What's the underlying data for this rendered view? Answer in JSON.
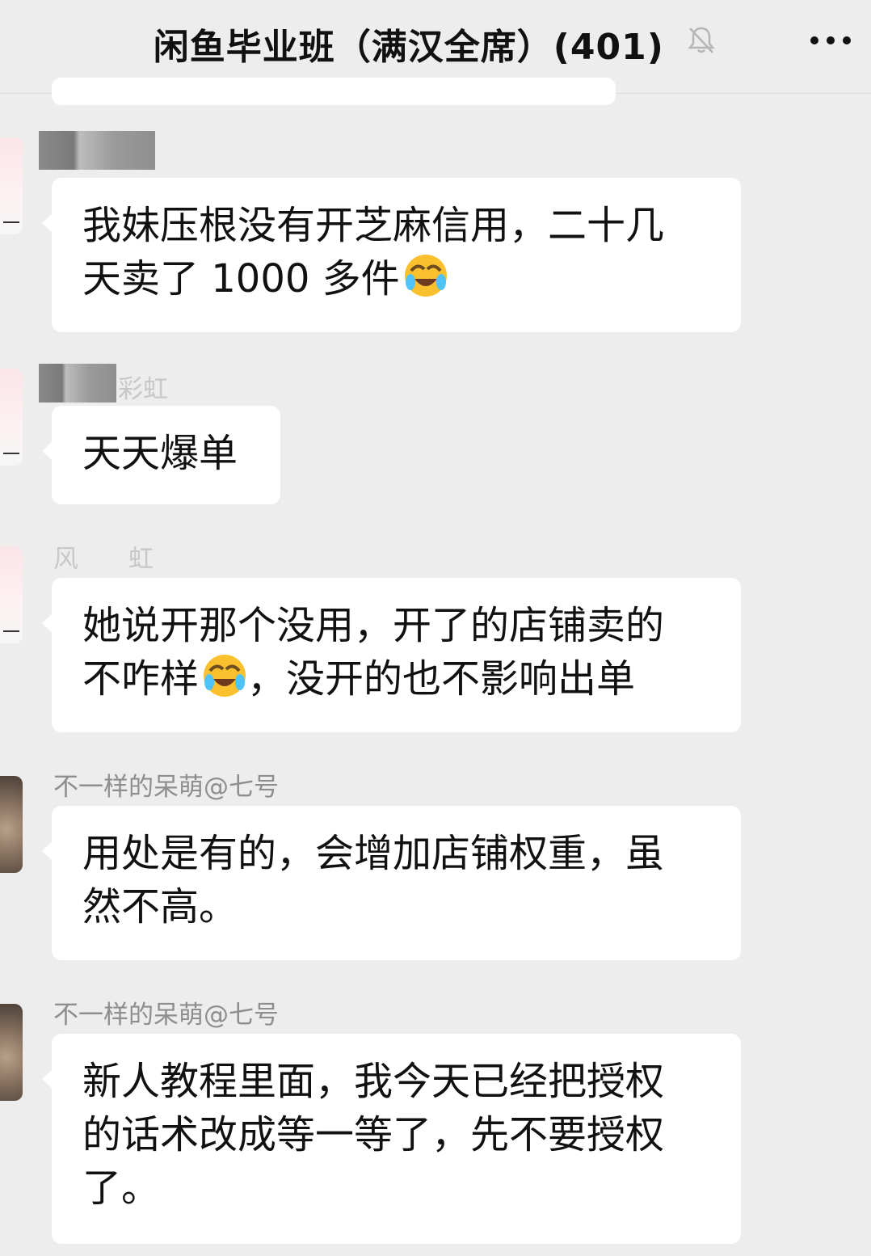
{
  "header": {
    "title": "闲鱼毕业班（满汉全席）(401)",
    "mute_icon": "bell-off-icon",
    "more_icon": "more-dots-icon"
  },
  "messages": [
    {
      "sender": "",
      "sender_partial": "",
      "text_line1": "我妹压根没有开芝麻信用，二十几",
      "text_line2": "天卖了 1000 多件",
      "emoji": "face-with-tears-of-joy"
    },
    {
      "sender": "",
      "sender_partial": "彩虹",
      "text": "天天爆单"
    },
    {
      "sender": "",
      "sender_partial": "风　　虹",
      "text_line1": "她说开那个没用，开了的店铺卖的",
      "text_line2a": "不咋样",
      "text_line2b": "，没开的也不影响出单",
      "emoji": "face-with-tears-of-joy"
    },
    {
      "sender": "不一样的呆萌@七号",
      "text_line1": "用处是有的，会增加店铺权重，虽",
      "text_line2": "然不高。"
    },
    {
      "sender": "不一样的呆萌@七号",
      "text_line1": "新人教程里面，我今天已经把授权",
      "text_line2": "的话术改成等一等了，先不要授权",
      "text_line3": "了。"
    }
  ],
  "colors": {
    "background": "#ededed",
    "bubble": "#ffffff",
    "sender_name": "#8e8e8e",
    "text": "#111111"
  }
}
